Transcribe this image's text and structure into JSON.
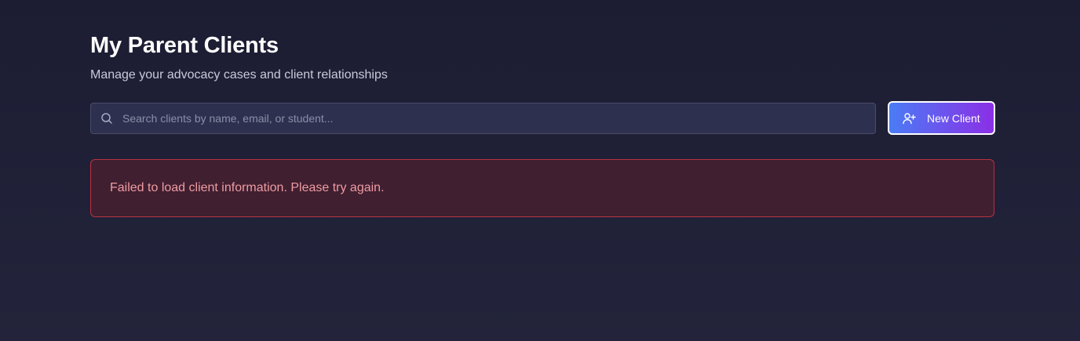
{
  "header": {
    "title": "My Parent Clients",
    "subtitle": "Manage your advocacy cases and client relationships"
  },
  "search": {
    "placeholder": "Search clients by name, email, or student...",
    "value": "",
    "icon": "search-icon"
  },
  "actions": {
    "new_client_label": "New Client",
    "new_client_icon": "user-plus-icon"
  },
  "alert": {
    "message": "Failed to load client information. Please try again.",
    "type": "error"
  },
  "colors": {
    "background": "#1c1d33",
    "accent_start": "#4a7cf5",
    "accent_end": "#8b2fe6",
    "error_border": "#b8323f",
    "error_background": "#401f30",
    "error_text": "#ee9ca2"
  }
}
